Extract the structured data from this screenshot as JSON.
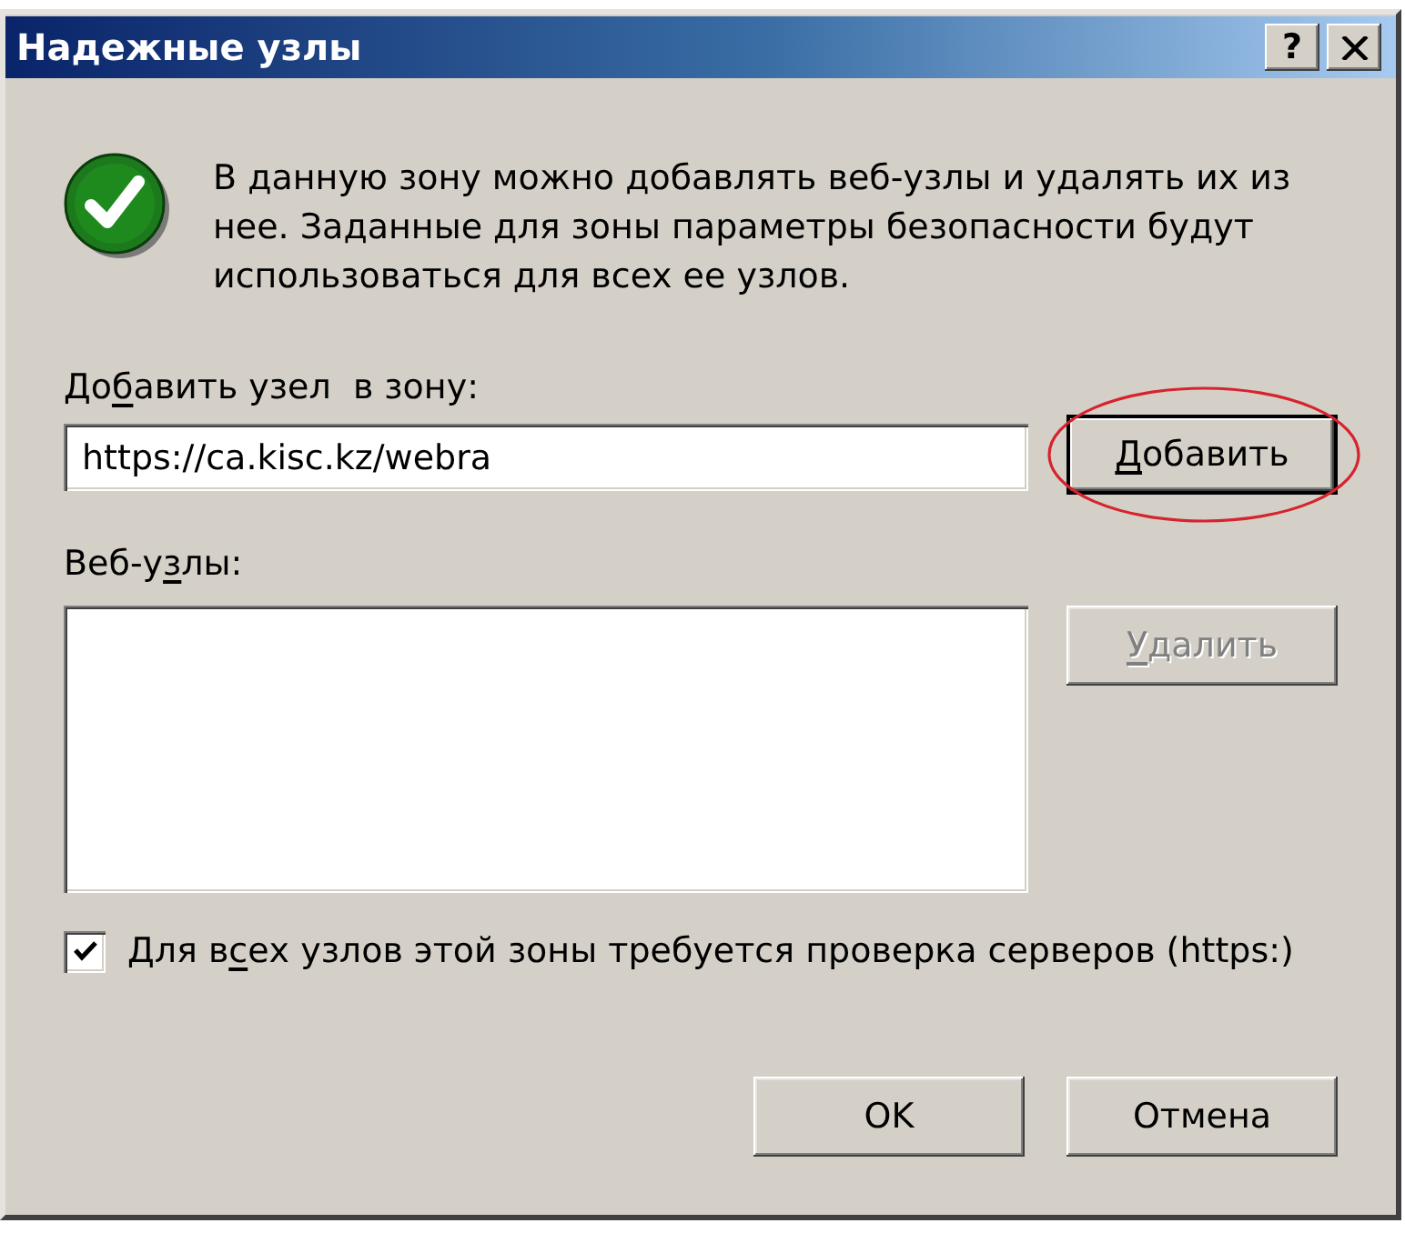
{
  "window": {
    "title": "Надежные узлы",
    "title_buttons": [
      {
        "kind": "help",
        "label": "?"
      },
      {
        "kind": "close"
      }
    ]
  },
  "info": {
    "text": "В данную зону можно добавлять веб-узлы и удалять их из нее. Заданные для зоны параметры безопасности будут использоваться для всех ее узлов."
  },
  "add_site": {
    "label": [
      {
        "text": "До",
        "underlined": false
      },
      {
        "text": "б",
        "underlined": true
      },
      {
        "text": "авить узел  в зону:",
        "underlined": false
      }
    ],
    "value": "https://ca.kisc.kz/webra"
  },
  "add_button": {
    "label": [
      {
        "text": "Д",
        "underlined": true
      },
      {
        "text": "обавить",
        "underlined": false
      }
    ],
    "default": true,
    "circled": true,
    "disabled": false
  },
  "sites_list": {
    "label": [
      {
        "text": "Веб-у",
        "underlined": false
      },
      {
        "text": "з",
        "underlined": true
      },
      {
        "text": "лы:",
        "underlined": false
      }
    ]
  },
  "remove_button": {
    "label": [
      {
        "text": "У",
        "underlined": true
      },
      {
        "text": "далить",
        "underlined": false
      }
    ],
    "default": false,
    "disabled": true
  },
  "require_https": {
    "label": [
      {
        "text": "Для в",
        "underlined": false
      },
      {
        "text": "с",
        "underlined": true
      },
      {
        "text": "ех узлов этой зоны требуется проверка серверов (https:)",
        "underlined": false
      }
    ],
    "checked": true
  },
  "buttons": [
    {
      "label": "OK",
      "default": false
    },
    {
      "label": "Отмена",
      "default": false
    }
  ]
}
